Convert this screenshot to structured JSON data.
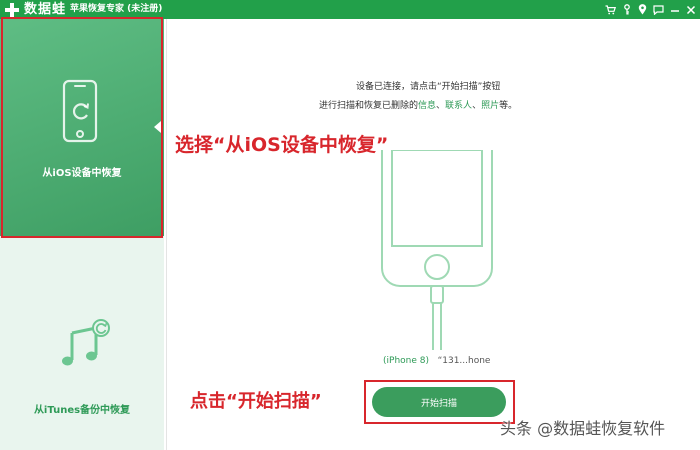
{
  "titlebar": {
    "logo_text": "数据蛙",
    "app_title": "苹果恢复专家 (未注册)",
    "icons": [
      "cart-icon",
      "key-icon",
      "location-icon",
      "message-icon",
      "minimize-icon",
      "close-icon"
    ]
  },
  "sidebar": {
    "items": [
      {
        "label": "从iOS设备中恢复",
        "icon": "phone-restore-icon",
        "active": true
      },
      {
        "label": "从iTunes备份中恢复",
        "icon": "itunes-music-icon",
        "active": false
      }
    ]
  },
  "main": {
    "instruction_line1": "设备已连接，请点击“开始扫描”按钮",
    "instruction_line2_prefix": "进行扫描和恢复已删除的",
    "instruction_links": [
      "信息",
      "联系人",
      "照片"
    ],
    "instruction_sep": "、",
    "instruction_suffix": "等。",
    "device_model": "(iPhone 8)",
    "device_name": "“131...hone",
    "start_button_label": "开始扫描"
  },
  "annotations": {
    "select_text": "选择“从iOS设备中恢复”",
    "click_text": "点击“开始扫描”"
  },
  "watermark": "头条 @数据蛙恢复软件",
  "colors": {
    "titlebar": "#22a04a",
    "sidebar_active": "#4caf72",
    "sidebar_bg": "#e9f5ee",
    "accent_green": "#2e9a57",
    "annotation_red": "#d8262c",
    "button": "#3b9d5d"
  }
}
